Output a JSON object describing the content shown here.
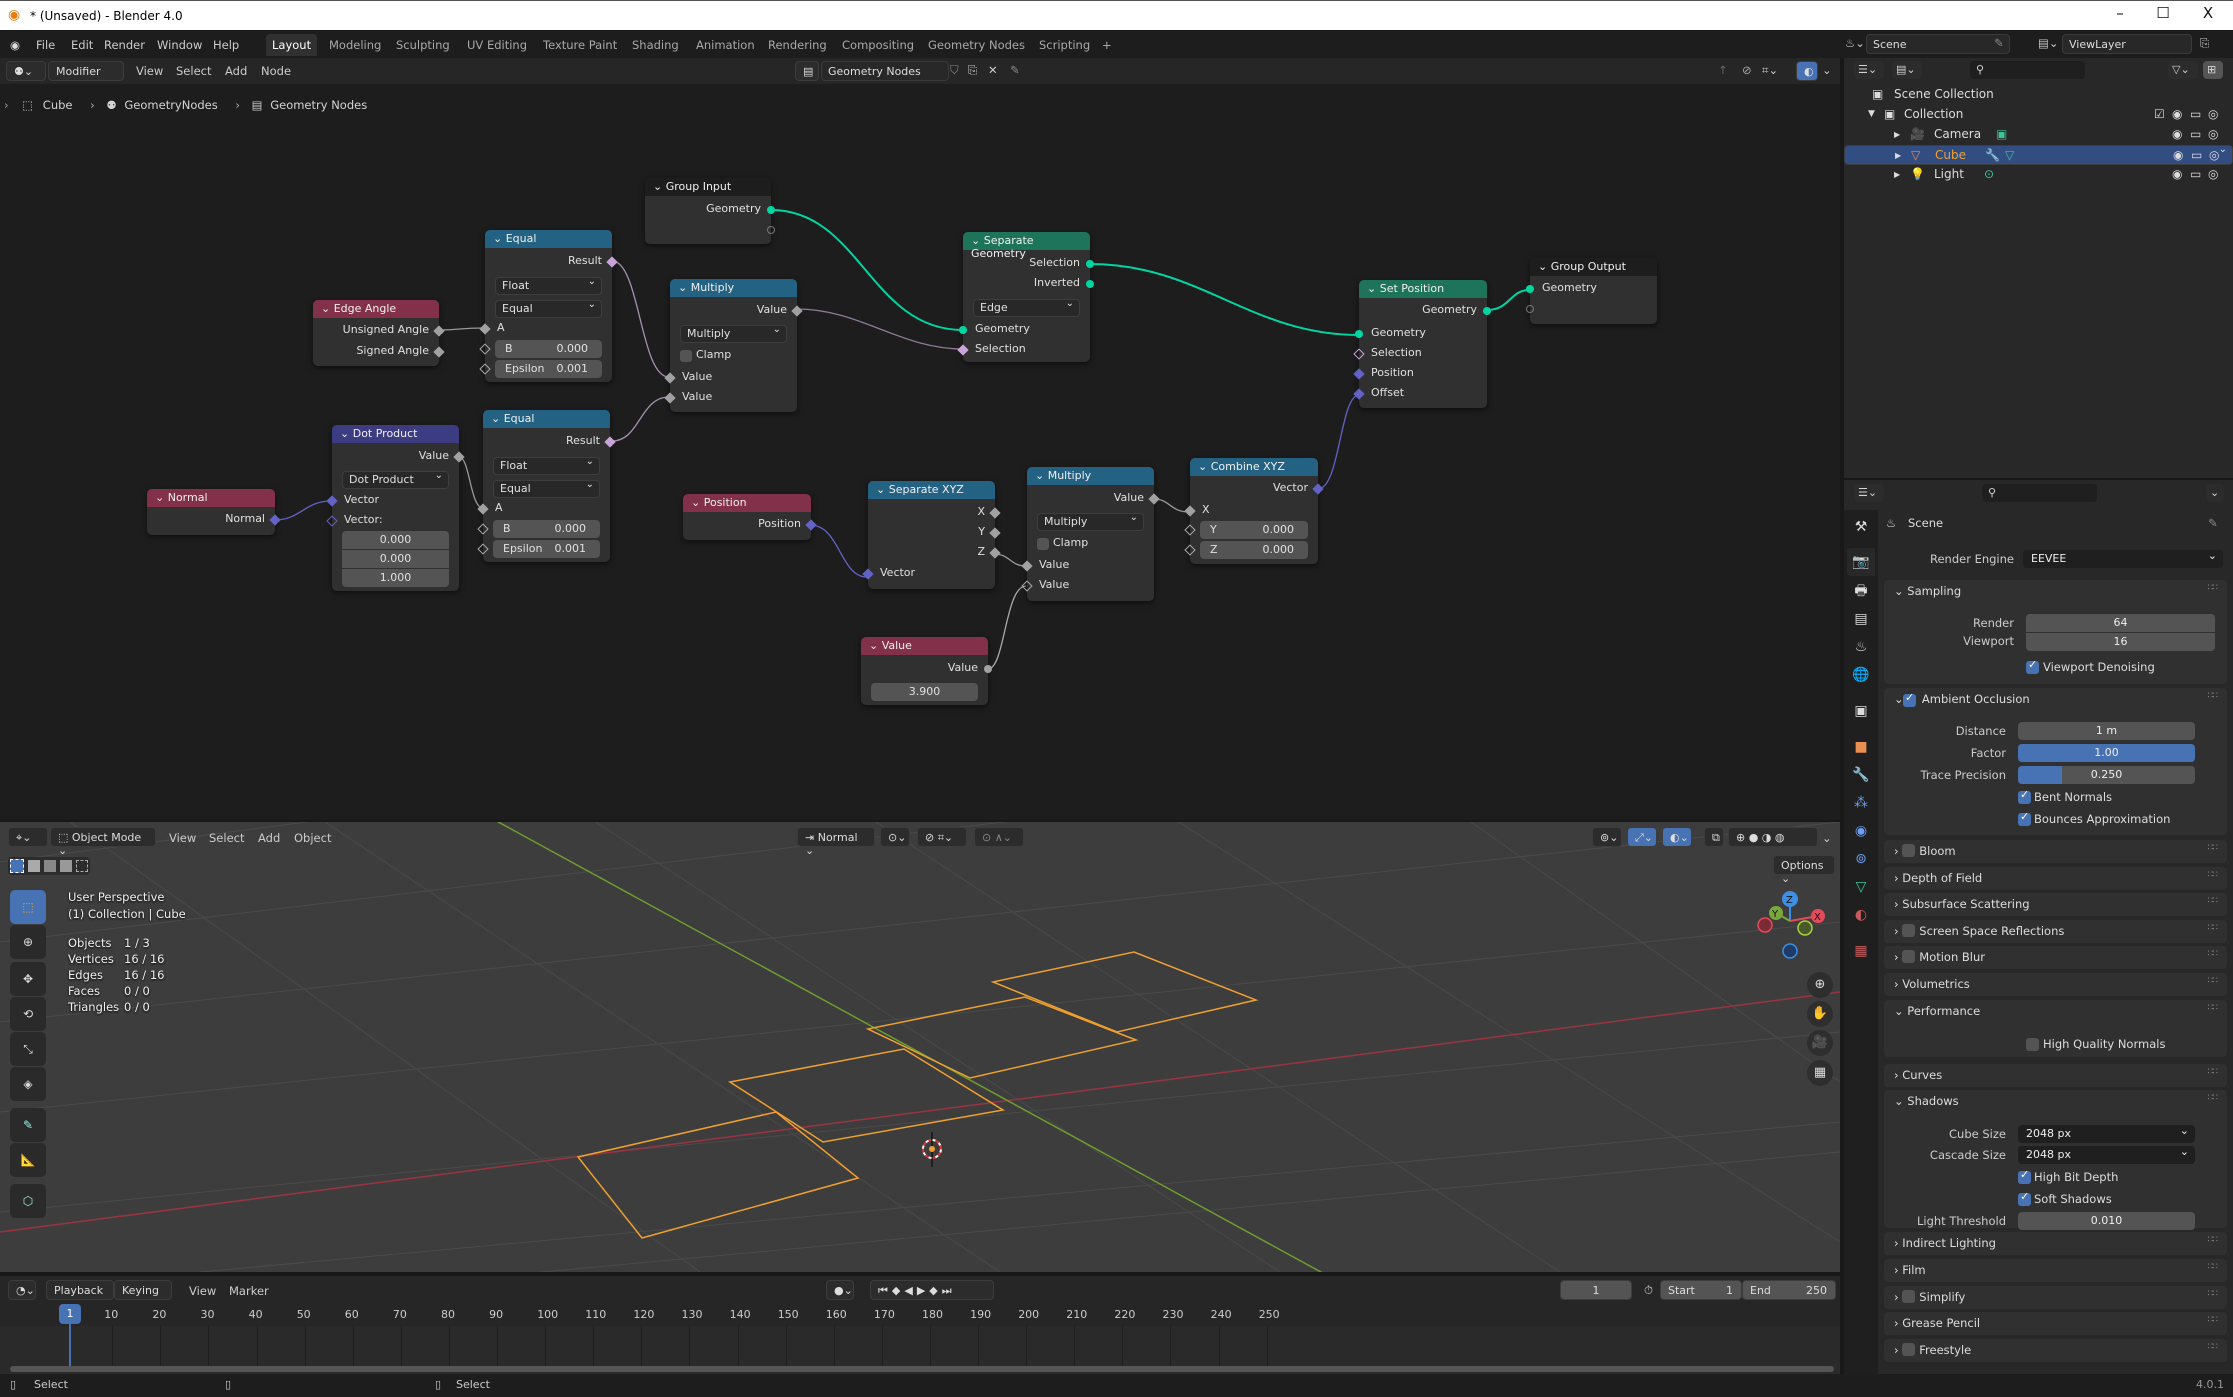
{
  "window": {
    "title": "* (Unsaved) - Blender 4.0",
    "minimize": "–",
    "maximize": "☐",
    "close": "X"
  },
  "menu": {
    "items": [
      "File",
      "Edit",
      "Render",
      "Window",
      "Help"
    ]
  },
  "workspaces": {
    "tabs": [
      "Layout",
      "Modeling",
      "Sculpting",
      "UV Editing",
      "Texture Paint",
      "Shading",
      "Animation",
      "Rendering",
      "Compositing",
      "Geometry Nodes",
      "Scripting"
    ],
    "active": "Layout",
    "add": "+"
  },
  "scene_selector": {
    "scene": "Scene",
    "view_layer": "ViewLayer"
  },
  "node_editor": {
    "header": {
      "context": "Modifier",
      "menus": [
        "View",
        "Select",
        "Add",
        "Node"
      ],
      "node_group": "Geometry Nodes"
    },
    "breadcrumb": [
      "Cube",
      "GeometryNodes",
      "Geometry Nodes"
    ],
    "nodes": {
      "group_input": {
        "title": "Group Input",
        "outputs": [
          "Geometry"
        ]
      },
      "equal1": {
        "title": "Equal",
        "output": "Result",
        "type": "Float",
        "mode": "Equal",
        "input_a": "A",
        "b_label": "B",
        "b_value": "0.000",
        "eps_label": "Epsilon",
        "eps_value": "0.001"
      },
      "equal2": {
        "title": "Equal",
        "output": "Result",
        "type": "Float",
        "mode": "Equal",
        "input_a": "A",
        "b_label": "B",
        "b_value": "0.000",
        "eps_label": "Epsilon",
        "eps_value": "0.001"
      },
      "edge_angle": {
        "title": "Edge Angle",
        "outputs": [
          "Unsigned Angle",
          "Signed Angle"
        ]
      },
      "multiply1": {
        "title": "Multiply",
        "output": "Value",
        "op": "Multiply",
        "clamp": "Clamp",
        "inputs": [
          "Value",
          "Value"
        ]
      },
      "separate_geometry": {
        "title": "Separate Geometry",
        "outputs": [
          "Selection",
          "Inverted"
        ],
        "domain": "Edge",
        "inputs": [
          "Geometry",
          "Selection"
        ]
      },
      "set_position": {
        "title": "Set Position",
        "output": "Geometry",
        "inputs": [
          "Geometry",
          "Selection",
          "Position",
          "Offset"
        ]
      },
      "group_output": {
        "title": "Group Output",
        "inputs": [
          "Geometry"
        ]
      },
      "dot_product": {
        "title": "Dot Product",
        "output": "Value",
        "op": "Dot Product",
        "inputs": [
          "Vector",
          "Vector:"
        ],
        "vec": [
          "0.000",
          "0.000",
          "1.000"
        ]
      },
      "normal": {
        "title": "Normal",
        "output": "Normal"
      },
      "position": {
        "title": "Position",
        "output": "Position"
      },
      "separate_xyz": {
        "title": "Separate XYZ",
        "outputs": [
          "X",
          "Y",
          "Z"
        ],
        "input": "Vector"
      },
      "multiply2": {
        "title": "Multiply",
        "output": "Value",
        "op": "Multiply",
        "clamp": "Clamp",
        "inputs": [
          "Value",
          "Value"
        ]
      },
      "combine_xyz": {
        "title": "Combine XYZ",
        "output": "Vector",
        "x": "X",
        "y_label": "Y",
        "y_value": "0.000",
        "z_label": "Z",
        "z_value": "0.000"
      },
      "value": {
        "title": "Value",
        "output": "Value",
        "value": "3.900"
      }
    }
  },
  "viewport": {
    "header": {
      "mode": "Object Mode",
      "menus": [
        "View",
        "Select",
        "Add",
        "Object"
      ],
      "orientation": "Normal",
      "options": "Options"
    },
    "overlay": {
      "perspective": "User Perspective",
      "collection": "(1) Collection | Cube"
    },
    "stats": [
      {
        "label": "Objects",
        "value": "1 / 3"
      },
      {
        "label": "Vertices",
        "value": "16 / 16"
      },
      {
        "label": "Edges",
        "value": "16 / 16"
      },
      {
        "label": "Faces",
        "value": "0 / 0"
      },
      {
        "label": "Triangles",
        "value": "0 / 0"
      }
    ],
    "gizmo": {
      "x": "X",
      "y": "Y",
      "z": "Z"
    }
  },
  "timeline": {
    "menus": [
      "Playback",
      "Keying",
      "View",
      "Marker"
    ],
    "current_frame": "1",
    "start_label": "Start",
    "start": "1",
    "end_label": "End",
    "end": "250",
    "ticks": [
      "10",
      "20",
      "30",
      "40",
      "50",
      "60",
      "70",
      "80",
      "90",
      "100",
      "110",
      "120",
      "130",
      "140",
      "150",
      "160",
      "170",
      "180",
      "190",
      "200",
      "210",
      "220",
      "230",
      "240",
      "250"
    ]
  },
  "statusbar": {
    "left": "Select",
    "right": "Select",
    "version": "4.0.1"
  },
  "outliner": {
    "root": "Scene Collection",
    "collection": "Collection",
    "objects": [
      {
        "name": "Camera",
        "selected": false
      },
      {
        "name": "Cube",
        "selected": true
      },
      {
        "name": "Light",
        "selected": false
      }
    ]
  },
  "properties": {
    "context": "Scene",
    "render_engine_label": "Render Engine",
    "render_engine": "EEVEE",
    "sampling": {
      "title": "Sampling",
      "render_label": "Render",
      "render": "64",
      "viewport_label": "Viewport",
      "viewport": "16",
      "denoise": "Viewport Denoising",
      "denoise_on": true
    },
    "ao": {
      "title": "Ambient Occlusion",
      "enabled": true,
      "distance_label": "Distance",
      "distance": "1 m",
      "factor_label": "Factor",
      "factor": "1.00",
      "factor_fraction": 1.0,
      "trace_label": "Trace Precision",
      "trace": "0.250",
      "trace_fraction": 0.25,
      "bent": "Bent Normals",
      "bounce": "Bounces Approximation"
    },
    "collapsed": [
      {
        "title": "Bloom",
        "checkbox": true
      },
      {
        "title": "Depth of Field",
        "checkbox": false
      },
      {
        "title": "Subsurface Scattering",
        "checkbox": false
      },
      {
        "title": "Screen Space Reflections",
        "checkbox": true
      },
      {
        "title": "Motion Blur",
        "checkbox": true
      },
      {
        "title": "Volumetrics",
        "checkbox": false
      }
    ],
    "performance": {
      "title": "Performance",
      "hq_normals": "High Quality Normals"
    },
    "curves": "Curves",
    "shadows": {
      "title": "Shadows",
      "cube_label": "Cube Size",
      "cube": "2048 px",
      "cascade_label": "Cascade Size",
      "cascade": "2048 px",
      "high_bit": "High Bit Depth",
      "soft": "Soft Shadows",
      "threshold_label": "Light Threshold",
      "threshold": "0.010"
    },
    "bottom": [
      {
        "title": "Indirect Lighting",
        "checkbox": false
      },
      {
        "title": "Film",
        "checkbox": false
      },
      {
        "title": "Simplify",
        "checkbox": true
      },
      {
        "title": "Grease Pencil",
        "checkbox": false
      },
      {
        "title": "Freestyle",
        "checkbox": true
      }
    ]
  }
}
